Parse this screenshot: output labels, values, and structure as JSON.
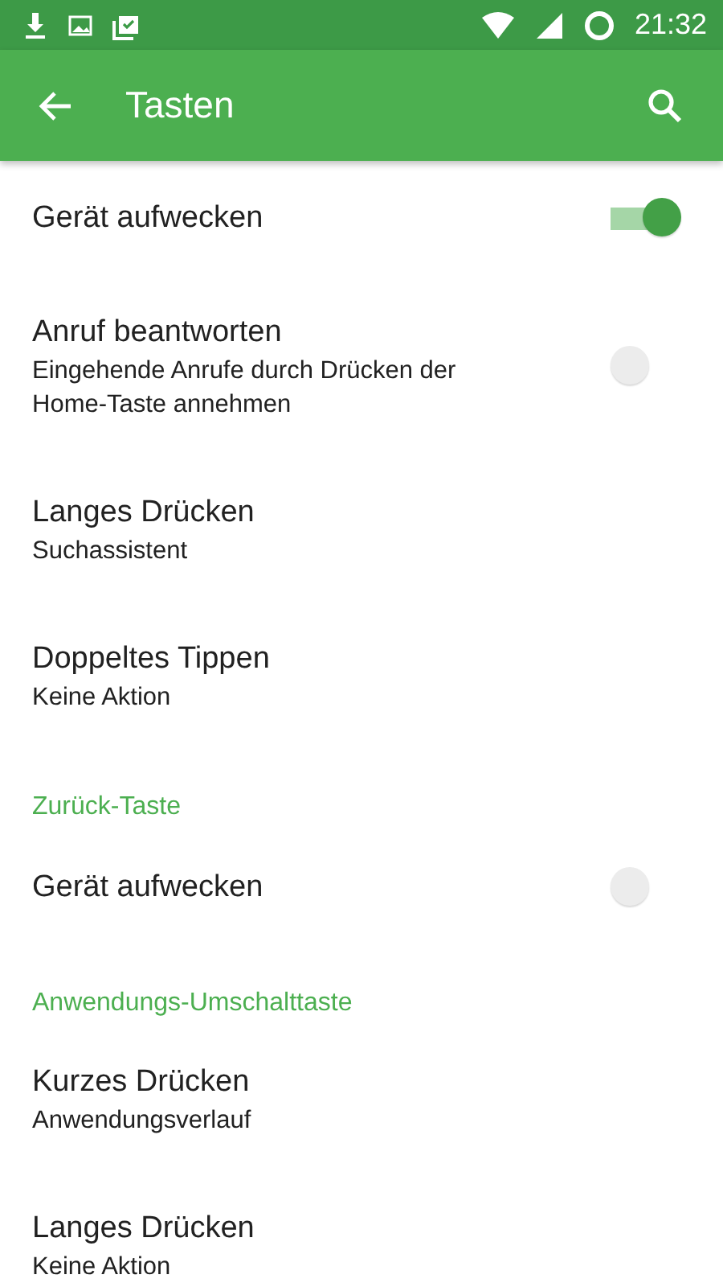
{
  "status_bar": {
    "time": "21:32"
  },
  "toolbar": {
    "title": "Tasten"
  },
  "items": [
    {
      "kind": "switch",
      "title": "Gerät aufwecken",
      "on": true
    },
    {
      "kind": "switch",
      "title": "Anruf beantworten",
      "summary": "Eingehende Anrufe durch Drücken der Home-Taste annehmen",
      "on": false
    },
    {
      "kind": "pref",
      "title": "Langes Drücken",
      "summary": "Suchassistent"
    },
    {
      "kind": "pref",
      "title": "Doppeltes Tippen",
      "summary": "Keine Aktion"
    },
    {
      "kind": "header",
      "title": "Zurück-Taste"
    },
    {
      "kind": "switch",
      "title": "Gerät aufwecken",
      "on": false
    },
    {
      "kind": "header",
      "title": "Anwendungs-Umschalttaste"
    },
    {
      "kind": "pref",
      "title": "Kurzes Drücken",
      "summary": "Anwendungsverlauf"
    },
    {
      "kind": "pref",
      "title": "Langes Drücken",
      "summary": "Keine Aktion"
    }
  ]
}
